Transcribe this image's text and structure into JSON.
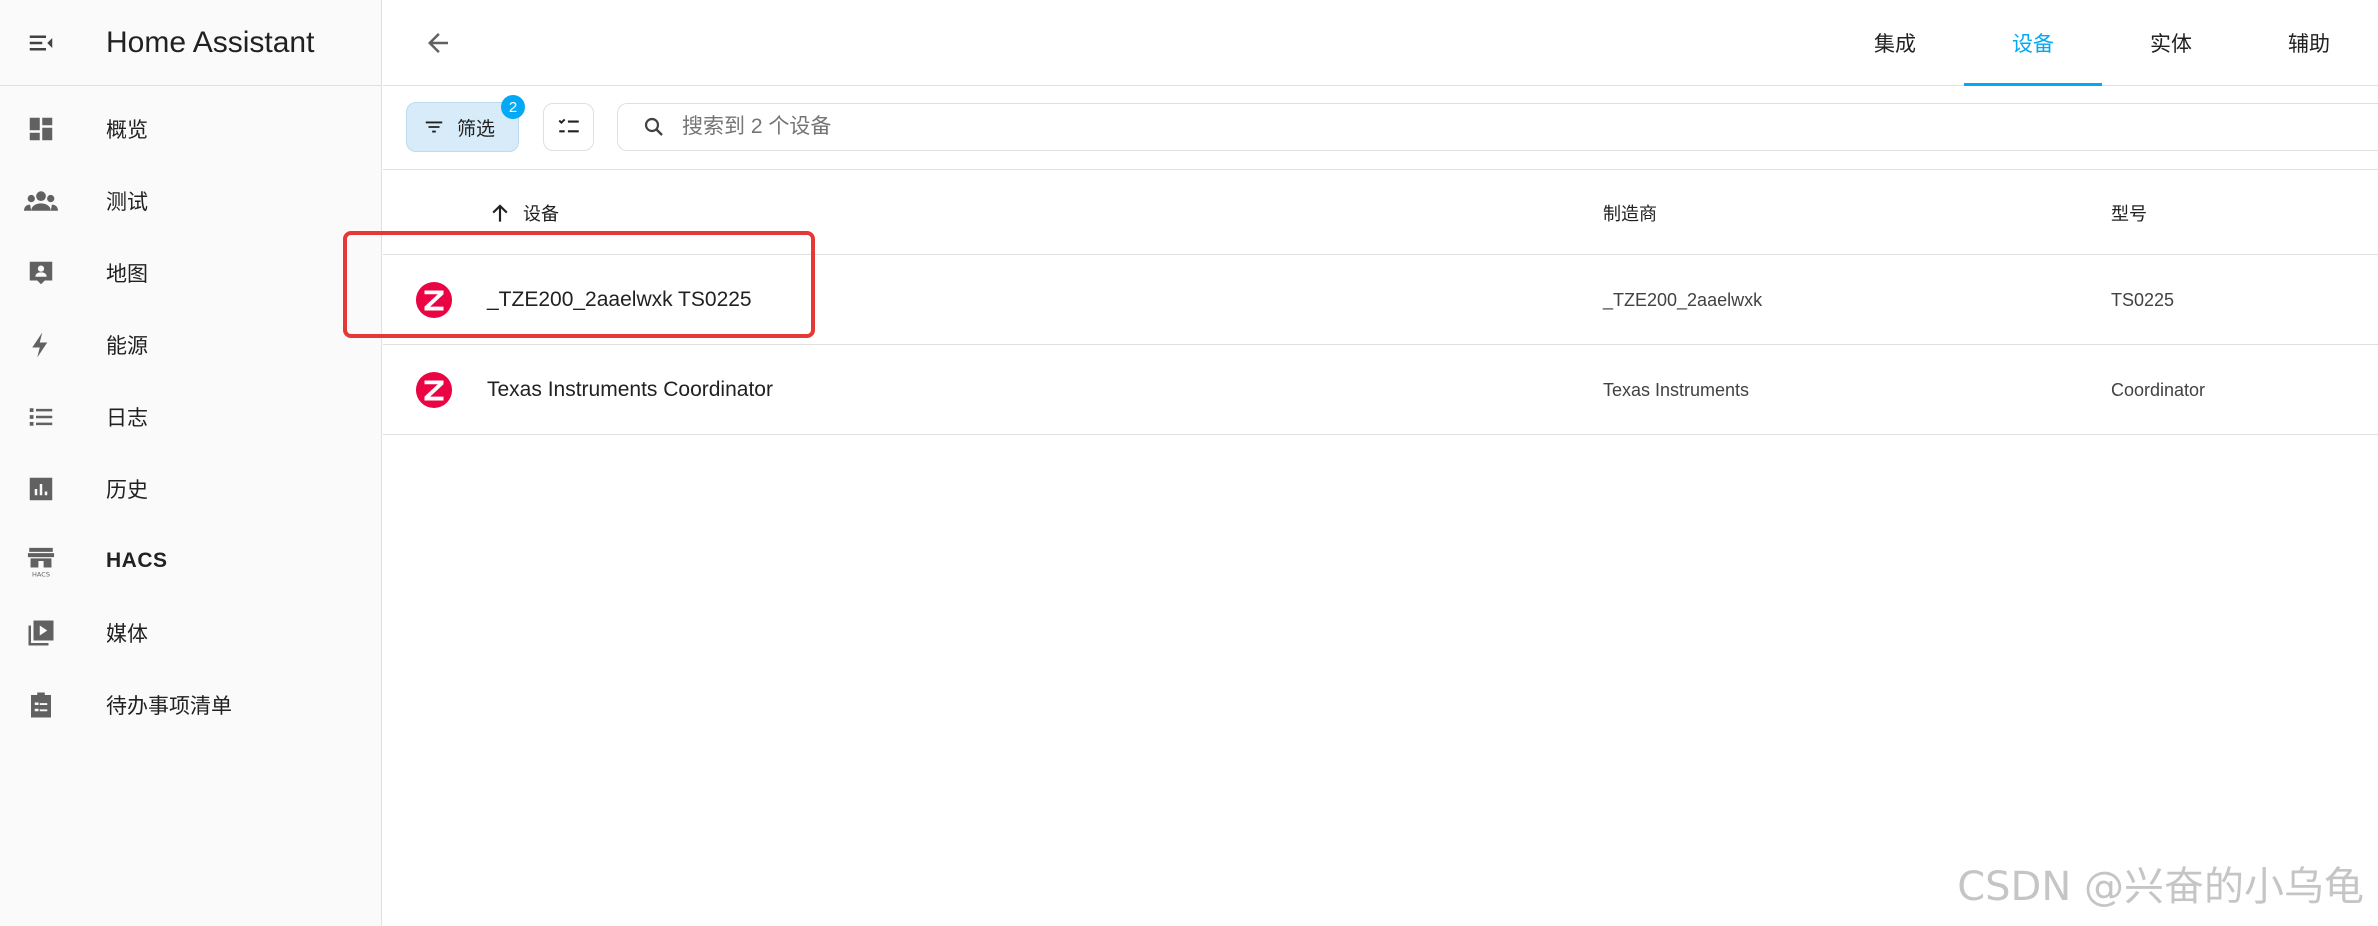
{
  "app": {
    "title": "Home Assistant"
  },
  "sidebar": {
    "items": [
      {
        "label": "概览",
        "icon": "dashboard-icon"
      },
      {
        "label": "测试",
        "icon": "people-icon"
      },
      {
        "label": "地图",
        "icon": "map-person-icon"
      },
      {
        "label": "能源",
        "icon": "lightning-icon"
      },
      {
        "label": "日志",
        "icon": "list-icon"
      },
      {
        "label": "历史",
        "icon": "chart-box-icon"
      },
      {
        "label": "HACS",
        "icon": "hacs-store-icon"
      },
      {
        "label": "媒体",
        "icon": "media-play-icon"
      },
      {
        "label": "待办事项清单",
        "icon": "clipboard-list-icon"
      }
    ]
  },
  "topbar": {
    "tabs": [
      {
        "label": "集成",
        "active": false
      },
      {
        "label": "设备",
        "active": true
      },
      {
        "label": "实体",
        "active": false
      },
      {
        "label": "辅助",
        "active": false
      }
    ]
  },
  "toolbar": {
    "filter_label": "筛选",
    "filter_count": "2",
    "search_placeholder": "搜索到 2 个设备",
    "search_value": ""
  },
  "table": {
    "columns": {
      "device": "设备",
      "manufacturer": "制造商",
      "model": "型号"
    },
    "sort_direction": "ascending",
    "rows": [
      {
        "name": "_TZE200_2aaelwxk TS0225",
        "manufacturer": "_TZE200_2aaelwxk",
        "model": "TS0225",
        "icon": "zigbee-icon"
      },
      {
        "name": "Texas Instruments Coordinator",
        "manufacturer": "Texas Instruments",
        "model": "Coordinator",
        "icon": "zigbee-icon"
      }
    ]
  },
  "colors": {
    "accent": "#03a9f4",
    "zigbee": "#eb0443",
    "highlight": "#e53935",
    "icon_gray": "#616161"
  },
  "watermark": "CSDN @兴奋的小乌龟"
}
